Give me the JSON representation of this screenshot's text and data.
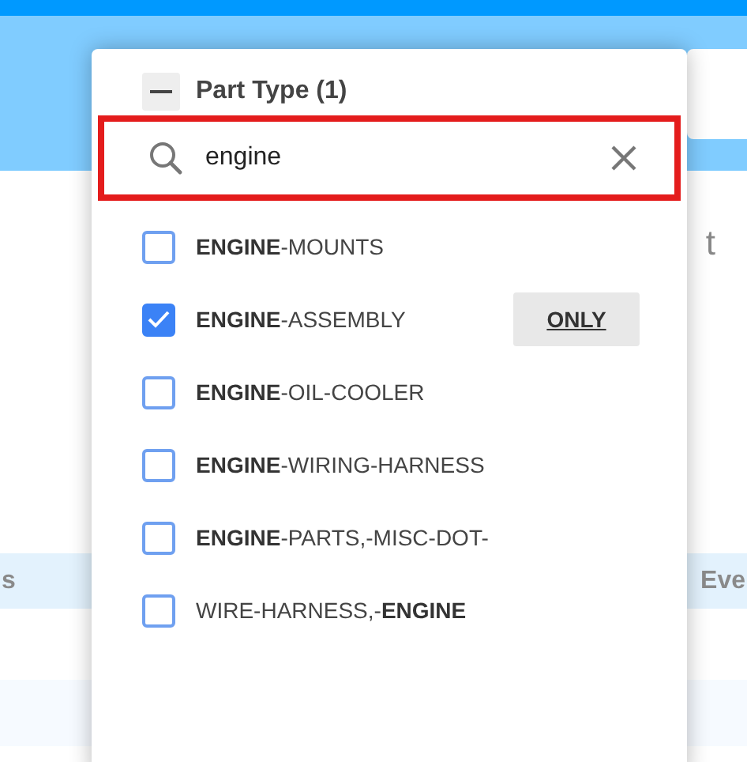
{
  "background": {
    "heading_fragment": "t",
    "columns": [
      {
        "label": "s"
      },
      {
        "label": "Eve"
      }
    ]
  },
  "filter": {
    "title": "Part Type (1)",
    "expanded": true,
    "search": {
      "value": "engine",
      "highlighted": true
    },
    "options": [
      {
        "label": "**ENGINE**-MOUNTS",
        "checked": false
      },
      {
        "label": "**ENGINE**-ASSEMBLY",
        "checked": true,
        "only": "ONLY"
      },
      {
        "label": "**ENGINE**-OIL-COOLER",
        "checked": false
      },
      {
        "label": "**ENGINE**-WIRING-HARNESS",
        "checked": false
      },
      {
        "label": "**ENGINE**-PARTS,-MISC-DOT-",
        "checked": false
      },
      {
        "label": "WIRE-HARNESS,-**ENGINE**",
        "checked": false
      }
    ]
  }
}
